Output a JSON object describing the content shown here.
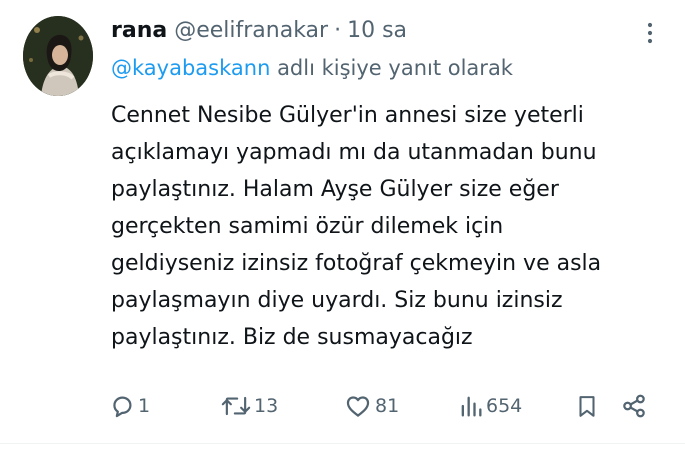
{
  "tweet": {
    "author_name": "rana",
    "author_handle": "@eelifranakar",
    "separator": "·",
    "time": "10 sa",
    "reply_mention": "@kayabaskann",
    "reply_suffix": " adlı kişiye yanıt olarak",
    "text_lines": [
      "Cennet Nesibe Gülyer'in annesi size yeterli",
      "açıklamayı yapmadı mı da utanmadan bunu",
      "paylaştınız. Halam Ayşe Gülyer size eğer",
      "gerçekten samimi özür dilemek için",
      "geldiyseniz izinsiz fotoğraf çekmeyin ve asla",
      "paylaşmayın diye uyardı. Siz bunu izinsiz",
      "paylaştınız. Biz de susmayacağız"
    ]
  },
  "actions": {
    "replies": "1",
    "reposts": "13",
    "likes": "81",
    "views": "654"
  },
  "icons": {
    "reply": "reply-icon",
    "repost": "repost-icon",
    "like": "heart-icon",
    "views": "views-icon",
    "bookmark": "bookmark-icon",
    "share": "share-icon",
    "more": "more-vertical-icon"
  },
  "colors": {
    "text": "#0f1419",
    "muted": "#536471",
    "link": "#1d9bf0"
  }
}
